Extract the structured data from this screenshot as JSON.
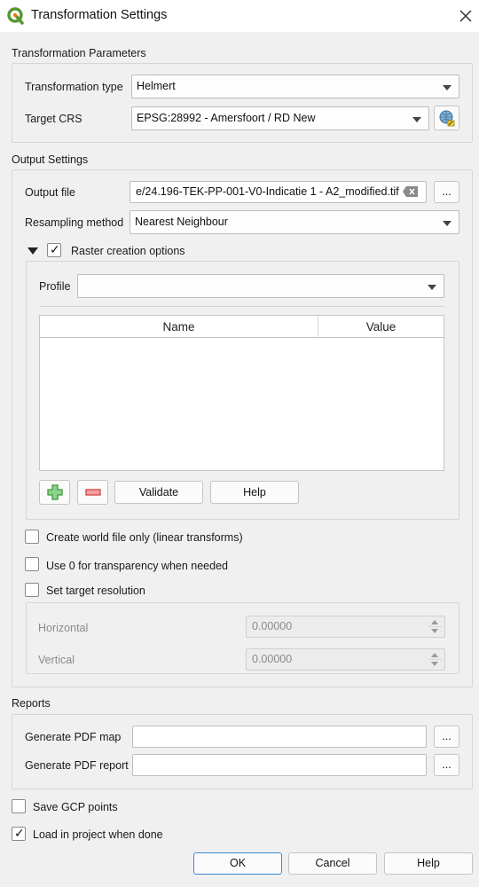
{
  "window": {
    "title": "Transformation Settings"
  },
  "transformation_parameters": {
    "title": "Transformation Parameters",
    "type_label": "Transformation type",
    "type_value": "Helmert",
    "crs_label": "Target CRS",
    "crs_value": "EPSG:28992 - Amersfoort / RD New"
  },
  "output_settings": {
    "title": "Output Settings",
    "output_file_label": "Output file",
    "output_file_value": "e/24.196-TEK-PP-001-V0-Indicatie 1 - A2_modified.tif",
    "browse_label": "...",
    "resampling_label": "Resampling method",
    "resampling_value": "Nearest Neighbour",
    "raster_options_label": "Raster creation options",
    "raster_options_checked": true,
    "profile_label": "Profile",
    "profile_value": "",
    "table_headers": [
      "Name",
      "Value"
    ],
    "validate_label": "Validate",
    "help_label": "Help",
    "world_file_label": "Create world file only (linear transforms)",
    "world_file_checked": false,
    "zero_transparency_label": "Use 0 for transparency when needed",
    "zero_transparency_checked": false,
    "target_res_label": "Set target resolution",
    "target_res_checked": false,
    "horizontal_label": "Horizontal",
    "horizontal_value": "0.00000",
    "vertical_label": "Vertical",
    "vertical_value": "0.00000"
  },
  "reports": {
    "title": "Reports",
    "pdf_map_label": "Generate PDF map",
    "pdf_map_value": "",
    "pdf_report_label": "Generate PDF report",
    "pdf_report_value": "",
    "browse_label": "..."
  },
  "options": {
    "save_gcp_label": "Save GCP points",
    "save_gcp_checked": false,
    "load_project_label": "Load in project when done",
    "load_project_checked": true,
    "check_mark": "✓"
  },
  "buttons": {
    "ok": "OK",
    "cancel": "Cancel",
    "help": "Help"
  },
  "colors": {
    "qgis_green": "#589632",
    "qgis_yellow": "#ee7913",
    "default_border": "#3c8ad6",
    "add_green": "#3c9b3c",
    "remove_red": "#d04545"
  }
}
